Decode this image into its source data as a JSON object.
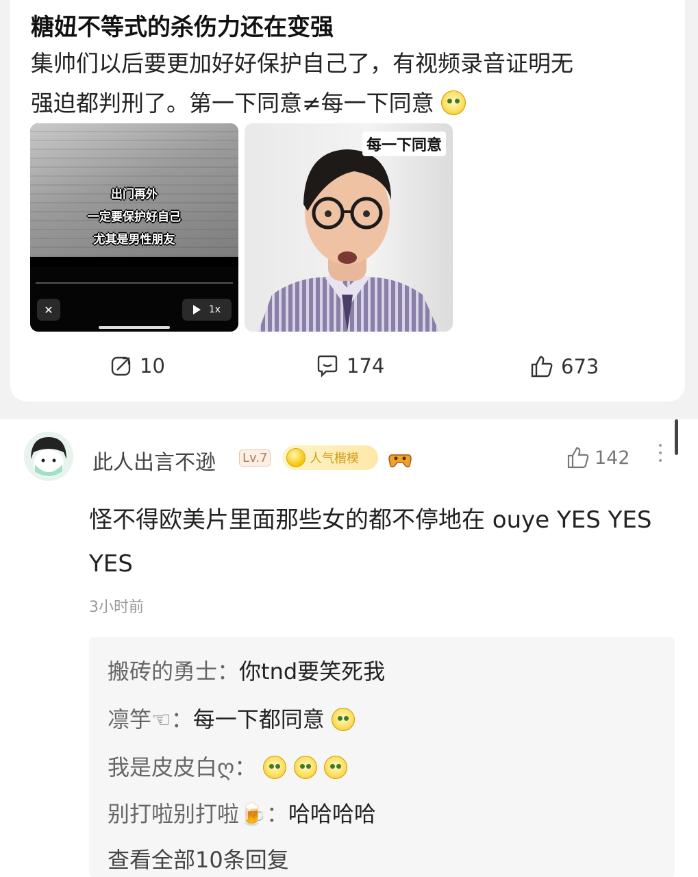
{
  "post": {
    "title": "糖妞不等式的杀伤力还在变强",
    "body_line1": "集帅们以后要更加好好保护自己了，有视频录音证明无",
    "body_line2": "强迫都判刑了。第一下同意≠每一下同意",
    "media1": {
      "subtitle_lines": [
        "出门再外",
        "一定要保护好自己",
        "尤其是男性朋友"
      ],
      "speed_label": "1x"
    },
    "media2": {
      "label": "每一下同意"
    },
    "stats": {
      "repost_count": "10",
      "comment_count": "174",
      "like_count": "673"
    }
  },
  "comment": {
    "username": "此人出言不逊",
    "level_badge": "Lv.7",
    "popularity_badge": "人气楷模",
    "like_count": "142",
    "text": "怪不得欧美片里面那些女的都不停地在 ouye YES YES YES",
    "time": "3小时前"
  },
  "replies": [
    {
      "user": "搬砖的勇士",
      "text": "你tnd要笑死我"
    },
    {
      "user": "凛竽☜",
      "text": "每一下都同意"
    },
    {
      "user": "我是皮皮白ღ",
      "text": ""
    },
    {
      "user": "别打啦别打啦🍺",
      "text": "哈哈哈哈"
    }
  ],
  "more_replies_label": "查看全部10条回复",
  "colors": {
    "page_bg": "#f2f2f2",
    "card_bg": "#ffffff",
    "reply_bg": "#f6f6f6",
    "badge_gold": "#d49a17",
    "level_badge": "#b07d5a"
  }
}
